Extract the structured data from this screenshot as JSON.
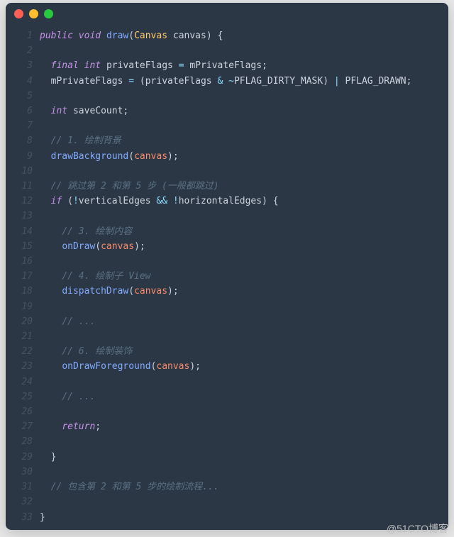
{
  "watermark": "@51CTO博客",
  "lines": [
    {
      "n": 1,
      "indent": 0,
      "tokens": [
        [
          "kw",
          "public"
        ],
        [
          "sp",
          " "
        ],
        [
          "type",
          "void"
        ],
        [
          "sp",
          " "
        ],
        [
          "func",
          "draw"
        ],
        [
          "punc",
          "("
        ],
        [
          "ident",
          "Canvas"
        ],
        [
          "sp",
          " "
        ],
        [
          "var",
          "canvas"
        ],
        [
          "punc",
          ")"
        ],
        [
          "sp",
          " "
        ],
        [
          "brace",
          "{"
        ]
      ]
    },
    {
      "n": 2,
      "indent": 0,
      "tokens": []
    },
    {
      "n": 3,
      "indent": 1,
      "tokens": [
        [
          "kw",
          "final"
        ],
        [
          "sp",
          " "
        ],
        [
          "type",
          "int"
        ],
        [
          "sp",
          " "
        ],
        [
          "var",
          "privateFlags"
        ],
        [
          "sp",
          " "
        ],
        [
          "op",
          "="
        ],
        [
          "sp",
          " "
        ],
        [
          "var",
          "mPrivateFlags"
        ],
        [
          "punc",
          ";"
        ]
      ]
    },
    {
      "n": 4,
      "indent": 1,
      "tokens": [
        [
          "var",
          "mPrivateFlags"
        ],
        [
          "sp",
          " "
        ],
        [
          "op",
          "="
        ],
        [
          "sp",
          " "
        ],
        [
          "punc",
          "("
        ],
        [
          "var",
          "privateFlags"
        ],
        [
          "sp",
          " "
        ],
        [
          "op",
          "&"
        ],
        [
          "sp",
          " "
        ],
        [
          "op",
          "~"
        ],
        [
          "var",
          "PFLAG_DIRTY_MASK"
        ],
        [
          "punc",
          ")"
        ],
        [
          "sp",
          " "
        ],
        [
          "op",
          "|"
        ],
        [
          "sp",
          " "
        ],
        [
          "var",
          "PFLAG_DRAWN"
        ],
        [
          "punc",
          ";"
        ]
      ]
    },
    {
      "n": 5,
      "indent": 0,
      "tokens": []
    },
    {
      "n": 6,
      "indent": 1,
      "tokens": [
        [
          "type",
          "int"
        ],
        [
          "sp",
          " "
        ],
        [
          "var",
          "saveCount"
        ],
        [
          "punc",
          ";"
        ]
      ]
    },
    {
      "n": 7,
      "indent": 0,
      "tokens": []
    },
    {
      "n": 8,
      "indent": 1,
      "tokens": [
        [
          "com",
          "// 1. 绘制背景"
        ]
      ]
    },
    {
      "n": 9,
      "indent": 1,
      "tokens": [
        [
          "func",
          "drawBackground"
        ],
        [
          "punc",
          "("
        ],
        [
          "param",
          "canvas"
        ],
        [
          "punc",
          ")"
        ],
        [
          "punc",
          ";"
        ]
      ]
    },
    {
      "n": 10,
      "indent": 0,
      "tokens": []
    },
    {
      "n": 11,
      "indent": 1,
      "tokens": [
        [
          "com",
          "// 跳过第 2 和第 5 步 (一般都跳过)"
        ]
      ]
    },
    {
      "n": 12,
      "indent": 1,
      "tokens": [
        [
          "kw",
          "if"
        ],
        [
          "sp",
          " "
        ],
        [
          "punc",
          "("
        ],
        [
          "op",
          "!"
        ],
        [
          "var",
          "verticalEdges"
        ],
        [
          "sp",
          " "
        ],
        [
          "op",
          "&&"
        ],
        [
          "sp",
          " "
        ],
        [
          "op",
          "!"
        ],
        [
          "var",
          "horizontalEdges"
        ],
        [
          "punc",
          ")"
        ],
        [
          "sp",
          " "
        ],
        [
          "brace",
          "{"
        ]
      ]
    },
    {
      "n": 13,
      "indent": 0,
      "tokens": []
    },
    {
      "n": 14,
      "indent": 2,
      "tokens": [
        [
          "com",
          "// 3. 绘制内容"
        ]
      ]
    },
    {
      "n": 15,
      "indent": 2,
      "tokens": [
        [
          "func",
          "onDraw"
        ],
        [
          "punc",
          "("
        ],
        [
          "param",
          "canvas"
        ],
        [
          "punc",
          ")"
        ],
        [
          "punc",
          ";"
        ]
      ]
    },
    {
      "n": 16,
      "indent": 0,
      "tokens": []
    },
    {
      "n": 17,
      "indent": 2,
      "tokens": [
        [
          "com",
          "// 4. 绘制子 View"
        ]
      ]
    },
    {
      "n": 18,
      "indent": 2,
      "tokens": [
        [
          "func",
          "dispatchDraw"
        ],
        [
          "punc",
          "("
        ],
        [
          "param",
          "canvas"
        ],
        [
          "punc",
          ")"
        ],
        [
          "punc",
          ";"
        ]
      ]
    },
    {
      "n": 19,
      "indent": 0,
      "tokens": []
    },
    {
      "n": 20,
      "indent": 2,
      "tokens": [
        [
          "com",
          "// ..."
        ]
      ]
    },
    {
      "n": 21,
      "indent": 0,
      "tokens": []
    },
    {
      "n": 22,
      "indent": 2,
      "tokens": [
        [
          "com",
          "// 6. 绘制装饰"
        ]
      ]
    },
    {
      "n": 23,
      "indent": 2,
      "tokens": [
        [
          "func",
          "onDrawForeground"
        ],
        [
          "punc",
          "("
        ],
        [
          "param",
          "canvas"
        ],
        [
          "punc",
          ")"
        ],
        [
          "punc",
          ";"
        ]
      ]
    },
    {
      "n": 24,
      "indent": 0,
      "tokens": []
    },
    {
      "n": 25,
      "indent": 2,
      "tokens": [
        [
          "com",
          "// ..."
        ]
      ]
    },
    {
      "n": 26,
      "indent": 0,
      "tokens": []
    },
    {
      "n": 27,
      "indent": 2,
      "tokens": [
        [
          "kw",
          "return"
        ],
        [
          "punc",
          ";"
        ]
      ]
    },
    {
      "n": 28,
      "indent": 0,
      "tokens": []
    },
    {
      "n": 29,
      "indent": 1,
      "tokens": [
        [
          "brace",
          "}"
        ]
      ]
    },
    {
      "n": 30,
      "indent": 0,
      "tokens": []
    },
    {
      "n": 31,
      "indent": 1,
      "tokens": [
        [
          "com",
          "// 包含第 2 和第 5 步的绘制流程..."
        ]
      ]
    },
    {
      "n": 32,
      "indent": 0,
      "tokens": []
    },
    {
      "n": 33,
      "indent": 0,
      "tokens": [
        [
          "brace",
          "}"
        ]
      ]
    }
  ]
}
